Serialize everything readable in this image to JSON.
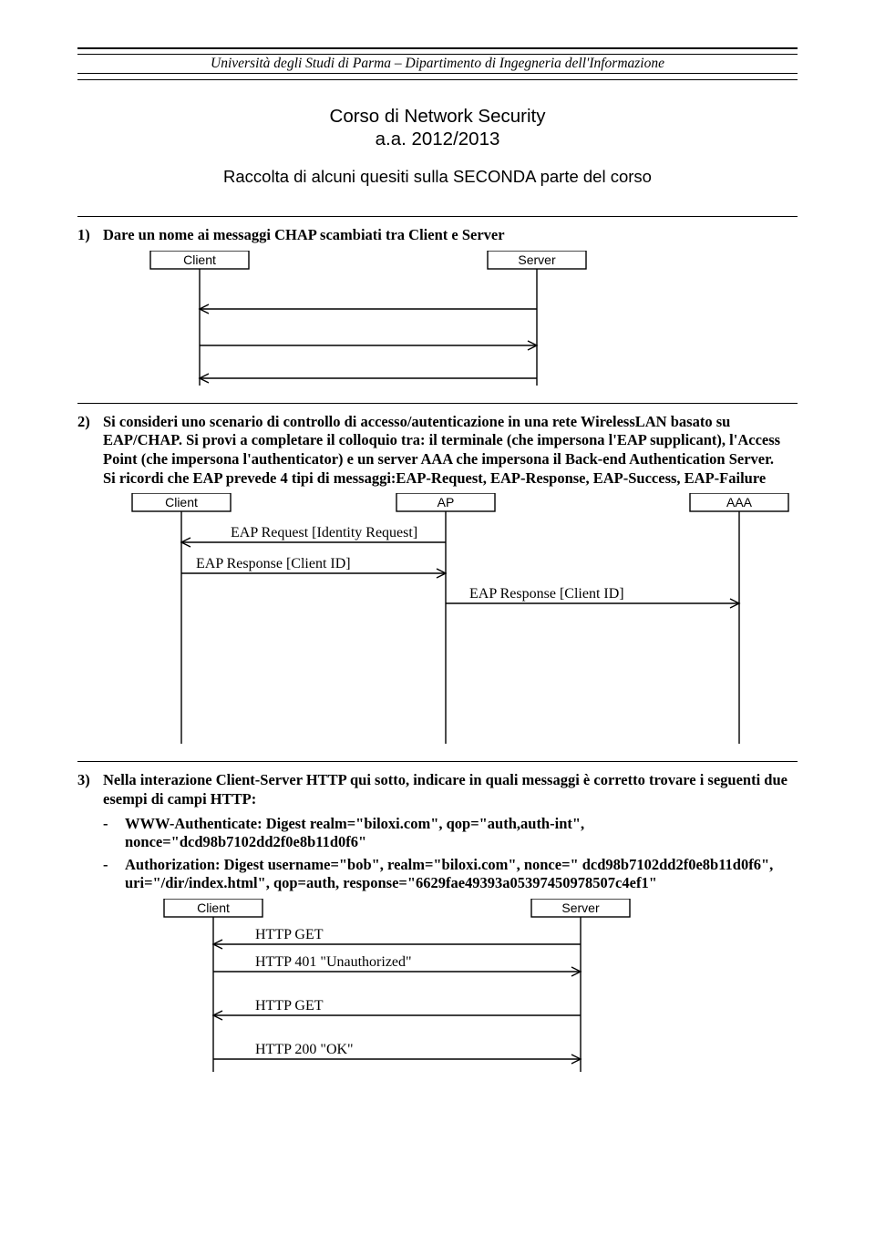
{
  "header": "Università degli Studi di Parma – Dipartimento di Ingegneria dell'Informazione",
  "title_line1": "Corso di Network Security",
  "title_line2": "a.a. 2012/2013",
  "subtitle": "Raccolta di alcuni quesiti sulla SECONDA parte del corso",
  "q1": {
    "num": "1)",
    "text": "Dare un nome ai messaggi CHAP scambiati tra Client e Server",
    "diagram": {
      "client": "Client",
      "server": "Server"
    }
  },
  "q2": {
    "num": "2)",
    "text": "Si consideri uno scenario di controllo di accesso/autenticazione in una rete WirelessLAN basato su EAP/CHAP. Si provi a completare il colloquio tra: il terminale (che impersona l'EAP supplicant), l'Access Point (che impersona l'authenticator) e un server AAA che impersona il Back-end Authentication Server.",
    "text2": "Si ricordi che EAP prevede 4 tipi di messaggi:EAP-Request, EAP-Response, EAP-Success, EAP-Failure",
    "diagram": {
      "client": "Client",
      "ap": "AP",
      "aaa": "AAA",
      "m1": "EAP Request [Identity Request]",
      "m2": "EAP Response [Client ID]",
      "m3": "EAP Response [Client ID]"
    }
  },
  "q3": {
    "num": "3)",
    "text": "Nella interazione Client-Server HTTP qui sotto, indicare in quali messaggi è corretto trovare i seguenti due esempi di campi HTTP:",
    "bullet1": "WWW-Authenticate: Digest realm=\"biloxi.com\", qop=\"auth,auth-int\", nonce=\"dcd98b7102dd2f0e8b11d0f6\"",
    "bullet2": "Authorization: Digest username=\"bob\", realm=\"biloxi.com\", nonce=\" dcd98b7102dd2f0e8b11d0f6\", uri=\"/dir/index.html\", qop=auth, response=\"6629fae49393a05397450978507c4ef1\"",
    "diagram": {
      "client": "Client",
      "server": "Server",
      "m1": "HTTP GET",
      "m2": "HTTP 401 \"Unauthorized\"",
      "m3": "HTTP GET",
      "m4": "HTTP 200 \"OK\""
    }
  }
}
